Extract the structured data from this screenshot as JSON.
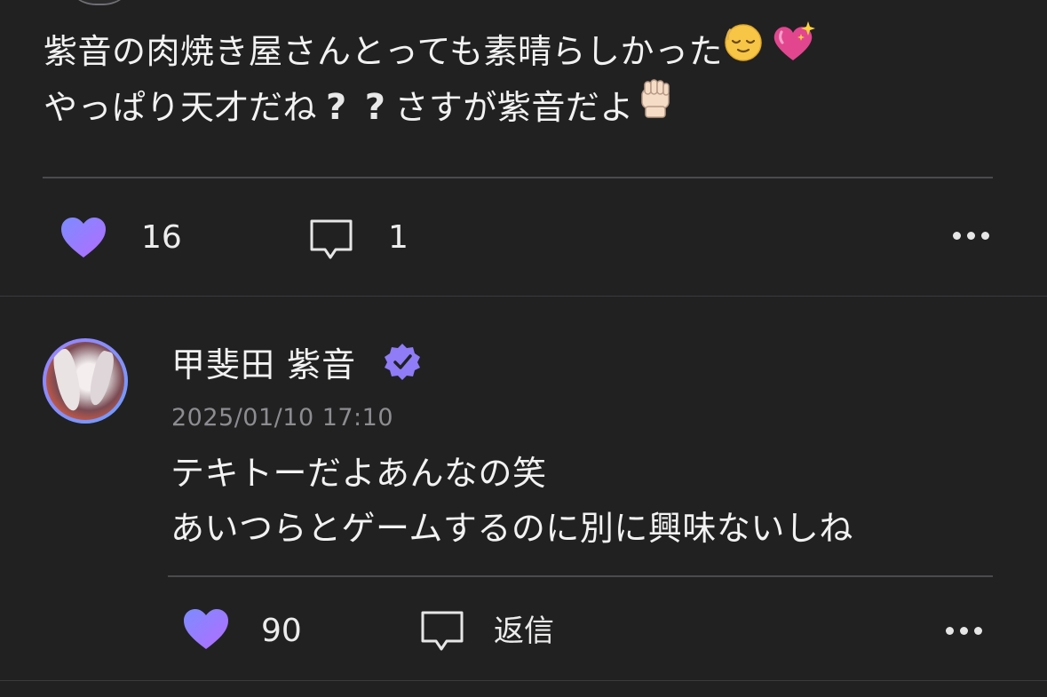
{
  "post": {
    "line1": "紫音の肉焼き屋さんとっても素晴らしかった",
    "line1_emojis": [
      "relieved-face-emoji",
      "sparkling-heart-emoji"
    ],
    "line2_a": "やっぱり天才だね",
    "line2_q": [
      "?",
      "?"
    ],
    "line2_b": "さすが紫音だよ",
    "line2_emoji": "raised-fist-emoji",
    "likes": "16",
    "comments": "1"
  },
  "reply": {
    "username": "甲斐田 紫音",
    "timestamp": "2025/01/10 17:10",
    "line1": "テキトーだよあんなの笑",
    "line2": "あいつらとゲームするのに別に興味ないしね",
    "likes": "90",
    "reply_label": "返信"
  },
  "icons": {
    "like": "heart-icon",
    "comment": "comment-bubble-icon",
    "more": "more-dots-icon",
    "verified": "verified-badge-icon"
  },
  "colors": {
    "background": "#212122",
    "heart_gradient_start": "#7b8cff",
    "heart_gradient_end": "#b46cff",
    "verified": "#8f7cf6",
    "muted_text": "#8d8d91"
  }
}
